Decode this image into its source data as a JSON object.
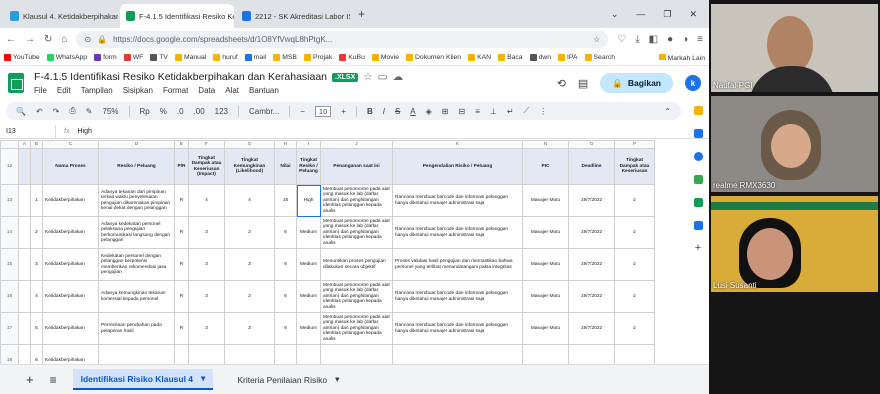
{
  "browser": {
    "tabs": [
      {
        "title": "Klausul 4. Ketidakberpihakan d",
        "color": "#2d9cdb",
        "active": false
      },
      {
        "title": "F-4.1.5 Identifikasi Resiko Ketid",
        "color": "#0f9d58",
        "active": true
      },
      {
        "title": "2212 - SK Akreditasi Labor ISO-1",
        "color": "#1a73e8",
        "active": false
      }
    ],
    "new_tab": "+",
    "url": "https://docs.google.com/spreadsheets/d/1O8YfVwqL8hPtgK...",
    "bookmarks": [
      {
        "label": "YouTube",
        "color": "#ff0000"
      },
      {
        "label": "WhatsApp",
        "color": "#25d366"
      },
      {
        "label": "form",
        "color": "#673ab7"
      },
      {
        "label": "WF",
        "color": "#e53935"
      },
      {
        "label": "TV",
        "color": "#555555"
      },
      {
        "label": "Manual",
        "color": "#f4b400"
      },
      {
        "label": "huruf",
        "color": "#f4b400"
      },
      {
        "label": "mail",
        "color": "#1a73e8"
      },
      {
        "label": "MSB",
        "color": "#f4b400"
      },
      {
        "label": "Projak",
        "color": "#f4b400"
      },
      {
        "label": "KuBu",
        "color": "#e53935"
      },
      {
        "label": "Movie",
        "color": "#f4b400"
      },
      {
        "label": "Dokumen Klien",
        "color": "#f4b400"
      },
      {
        "label": "KAN",
        "color": "#f4b400"
      },
      {
        "label": "Baca",
        "color": "#f4b400"
      },
      {
        "label": "dwn",
        "color": "#555555"
      },
      {
        "label": "IPA",
        "color": "#f4b400"
      },
      {
        "label": "Search",
        "color": "#f4b400"
      }
    ],
    "bookmarks_other": "Markah Lain"
  },
  "doc": {
    "title": "F-4.1.5 Identifikasi Resiko Ketidakberpihakan dan Kerahasiaan",
    "badge": ".XLSX",
    "menus": [
      "File",
      "Edit",
      "Tampilan",
      "Sisipkan",
      "Format",
      "Data",
      "Alat",
      "Bantuan"
    ],
    "share_label": "Bagikan",
    "avatar_letter": "k"
  },
  "toolbar": {
    "zoom": "75%",
    "currency": "Rp",
    "percent": "%",
    "decimals_dec": ".0",
    "decimals_inc": ".00",
    "number_format": "123",
    "font": "Cambr...",
    "font_size": "10"
  },
  "formula": {
    "cell": "I13",
    "fx": "fx",
    "content": "High"
  },
  "grid": {
    "col_letters": [
      "A",
      "B",
      "C",
      "D",
      "E",
      "F",
      "G",
      "H",
      "I",
      "J",
      "K",
      "L",
      "M",
      "N",
      "O",
      "P"
    ],
    "header_row_num": "12",
    "headers": [
      "Nama Proses",
      "Resiko / Peluang",
      "P/R",
      "Tingkat Dampak atau Keseriusan (Impact)",
      "Tingkat Kemungkinan (Likelihood)",
      "Nilai",
      "Tingkat Resiko / Peluang",
      "Penanganan saat ini",
      "Pengendalian Risiko / Peluang",
      "PIC",
      "Deadline",
      "Tingkat Dampak atau Keseriusan"
    ],
    "rows": [
      {
        "num": "13",
        "no": "1",
        "proses": "Ketidakberpihakan",
        "resiko": "Adanya tekanan dari pimpinan terkait waktu penyelesaian pengujian dikarenakan pimpinan kenal dekat dengan pelanggan",
        "pr": "R",
        "dampak": "4",
        "kemungkinan": "4",
        "nilai": "16",
        "tingkat": "High",
        "penanganan": "Membuat penomoran pada alat yang masuk ke lab (daftar antrian) dan penghilangan identitas pelanggan kepada analis",
        "pengendalian": "Rancana membuat barcode dan informasi pelanggan hanya diketahui manajer administrasi saja",
        "pic": "Manajer Mutu",
        "deadline": "19/7/2022",
        "last": "2"
      },
      {
        "num": "14",
        "no": "2",
        "proses": "Ketidakberpihakan",
        "resiko": "Adanya kedekatan personel pelaksana pengujian berkomunikasi langsung dengan pelanggan",
        "pr": "R",
        "dampak": "3",
        "kemungkinan": "2",
        "nilai": "6",
        "tingkat": "Medium",
        "penanganan": "Membuat penomoran pada alat yang masuk ke lab (daftar antrian) dan penghilangan identitas pelanggan kepada analis",
        "pengendalian": "Rancana membuat barcode dan informasi pelanggan hanya diketahui manajer administrasi saja",
        "pic": "Manajer Mutu",
        "deadline": "19/7/2022",
        "last": "2"
      },
      {
        "num": "15",
        "no": "3",
        "proses": "Ketidakberpihakan",
        "resiko": "Kedekatan personel dengan pelanggan berpotensi memberikan rekomendasi jasa pengujian",
        "pr": "R",
        "dampak": "3",
        "kemungkinan": "3",
        "nilai": "9",
        "tingkat": "Medium",
        "penanganan": "Menuntikan proses pengujian dilakukan secara objektif",
        "pengendalian": "Proses validasi hasil pengujian dan memastikan bahwa personel yang terlibat menandatangani pakta integritas",
        "pic": "Manajer Mutu",
        "deadline": "19/7/2022",
        "last": "2"
      },
      {
        "num": "16",
        "no": "4",
        "proses": "Ketidakberpihakan",
        "resiko": "Adanya kemungkinan tekanan komersial kepada personel",
        "pr": "R",
        "dampak": "3",
        "kemungkinan": "2",
        "nilai": "6",
        "tingkat": "Medium",
        "penanganan": "Membuat penomoran pada alat yang masuk ke lab (daftar antrian) dan penghilangan identitas pelanggan kepada analis",
        "pengendalian": "Rancana membuat barcode dan informasi pelanggan hanya diketahui manajer administrasi saja",
        "pic": "Manajer Mutu",
        "deadline": "19/7/2022",
        "last": "2"
      },
      {
        "num": "17",
        "no": "5",
        "proses": "Ketidakberpihakan",
        "resiko": "Permintaan perubahan pada pelaporan hasil",
        "pr": "R",
        "dampak": "3",
        "kemungkinan": "3",
        "nilai": "9",
        "tingkat": "Medium",
        "penanganan": "Membuat penomoran pada alat yang masuk ke lab (daftar antrian) dan penghilangan identitas pelanggan kepada analis",
        "pengendalian": "Rancana membuat barcode dan informasi pelanggan hanya diketahui manajer administrasi saja",
        "pic": "Manajer Mutu",
        "deadline": "19/7/2022",
        "last": "2"
      },
      {
        "num": "18",
        "no": "6",
        "proses": "Ketidakberpihakan",
        "resiko": "",
        "pr": "",
        "dampak": "",
        "kemungkinan": "",
        "nilai": "",
        "tingkat": "",
        "penanganan": "",
        "pengendalian": "",
        "pic": "",
        "deadline": "",
        "last": ""
      }
    ]
  },
  "sheet_tabs": {
    "add": "+",
    "list": "≡",
    "tabs": [
      "Identifikasi Risiko Klausul 4",
      "Kriteria Penilaian Risiko"
    ],
    "arrow": "▾"
  },
  "video": {
    "participants": [
      {
        "name": "Naufal-PGI",
        "bg": "#c9c4bb"
      },
      {
        "name": "realme RMX3630",
        "bg": "#8d8a86"
      },
      {
        "name": "Lusi Susanti",
        "bg": "#d9ac3a"
      }
    ]
  }
}
